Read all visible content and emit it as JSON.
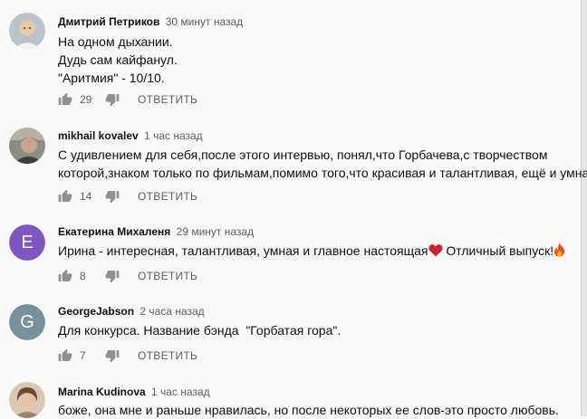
{
  "comments": [
    {
      "author": "Дмитрий Петриков",
      "time": "30 минут назад",
      "lines": [
        "На одном дыхании.",
        "Дудь сам кайфанул.",
        "\"Аритмия\" - 10/10."
      ],
      "likes": "29",
      "reply": "ОТВЕТИТЬ"
    },
    {
      "author": "mikhail kovalev",
      "time": "1 час назад",
      "lines": [
        "С удивлением для себя,после этого интервью, понял,что Горбачева,с творчеством",
        "которой,знаком только по фильмам,помимо того,что красивая и талантливая, ещё и умная"
      ],
      "likes": "14",
      "reply": "ОТВЕТИТЬ"
    },
    {
      "author": "Екатерина Михаленя",
      "time": "29 минут назад",
      "avatar_letter": "Е",
      "avatar_color": "#7e57c2",
      "text_before": "Ирина - интересная, талантливая, умная и главное настоящая",
      "text_middle": " Отличный выпуск!",
      "likes": "8",
      "reply": "ОТВЕТИТЬ"
    },
    {
      "author": "GeorgeJabson",
      "time": "2 часа назад",
      "avatar_letter": "G",
      "avatar_color": "#78909c",
      "lines": [
        "Для конкурса. Название бэнда  \"Горбатая гора\"."
      ],
      "likes": "7",
      "reply": "ОТВЕТИТЬ"
    },
    {
      "author": "Marina Kudinova",
      "time": "1 час назад",
      "lines": [
        "боже, она мне и раньше нравилась, но после некоторых ее слов-это просто любовь."
      ]
    }
  ],
  "icons": {
    "like": "thumbs-up-icon",
    "dislike": "thumbs-down-icon",
    "heart": "heart-emoji-icon",
    "fire": "fire-emoji-icon"
  }
}
